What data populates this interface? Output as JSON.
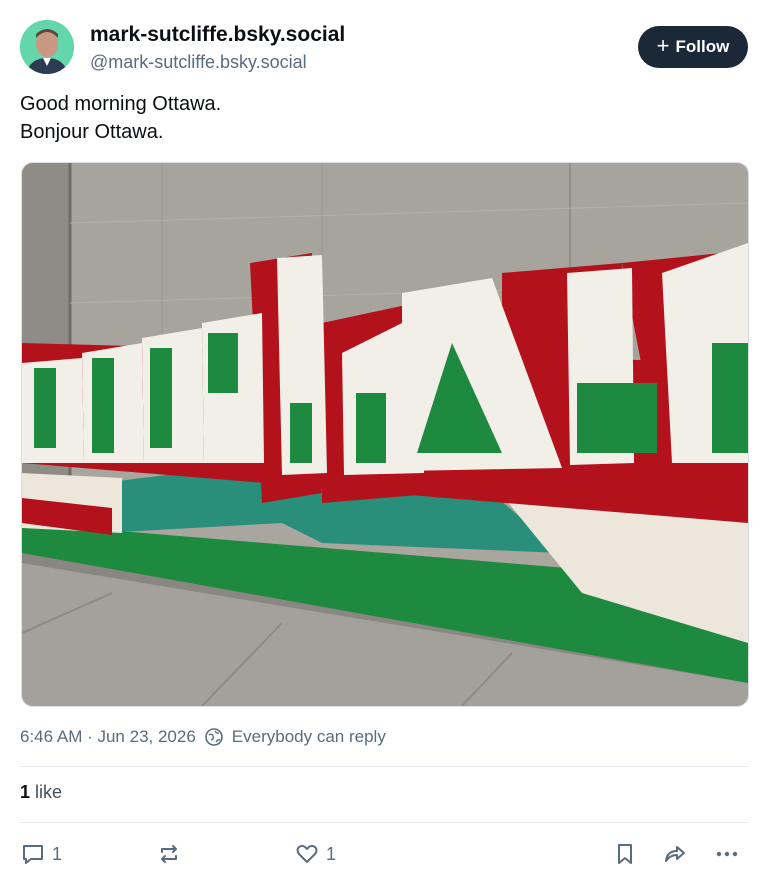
{
  "author": {
    "display_name": "mark-sutcliffe.bsky.social",
    "handle": "@mark-sutcliffe.bsky.social",
    "avatar_icon": "profile-photo"
  },
  "follow_button": {
    "label": "Follow",
    "icon": "plus-icon"
  },
  "post": {
    "lines": [
      "Good morning Ottawa.",
      "Bonjour Ottawa."
    ],
    "image_icon": "little-italy-mural-photo"
  },
  "meta": {
    "timestamp": "6:46 AM · Jun 23, 2026",
    "reply_setting": "Everybody can reply"
  },
  "likes": {
    "count": "1",
    "label": "like"
  },
  "actions": {
    "reply_count": "1",
    "like_count": "1"
  },
  "colors": {
    "follow_bg": "#1b2838",
    "mural_red": "#b3121d",
    "mural_green": "#1e8a3f",
    "mural_teal": "#2a8f7a",
    "wall_gray": "#a6a29c"
  }
}
